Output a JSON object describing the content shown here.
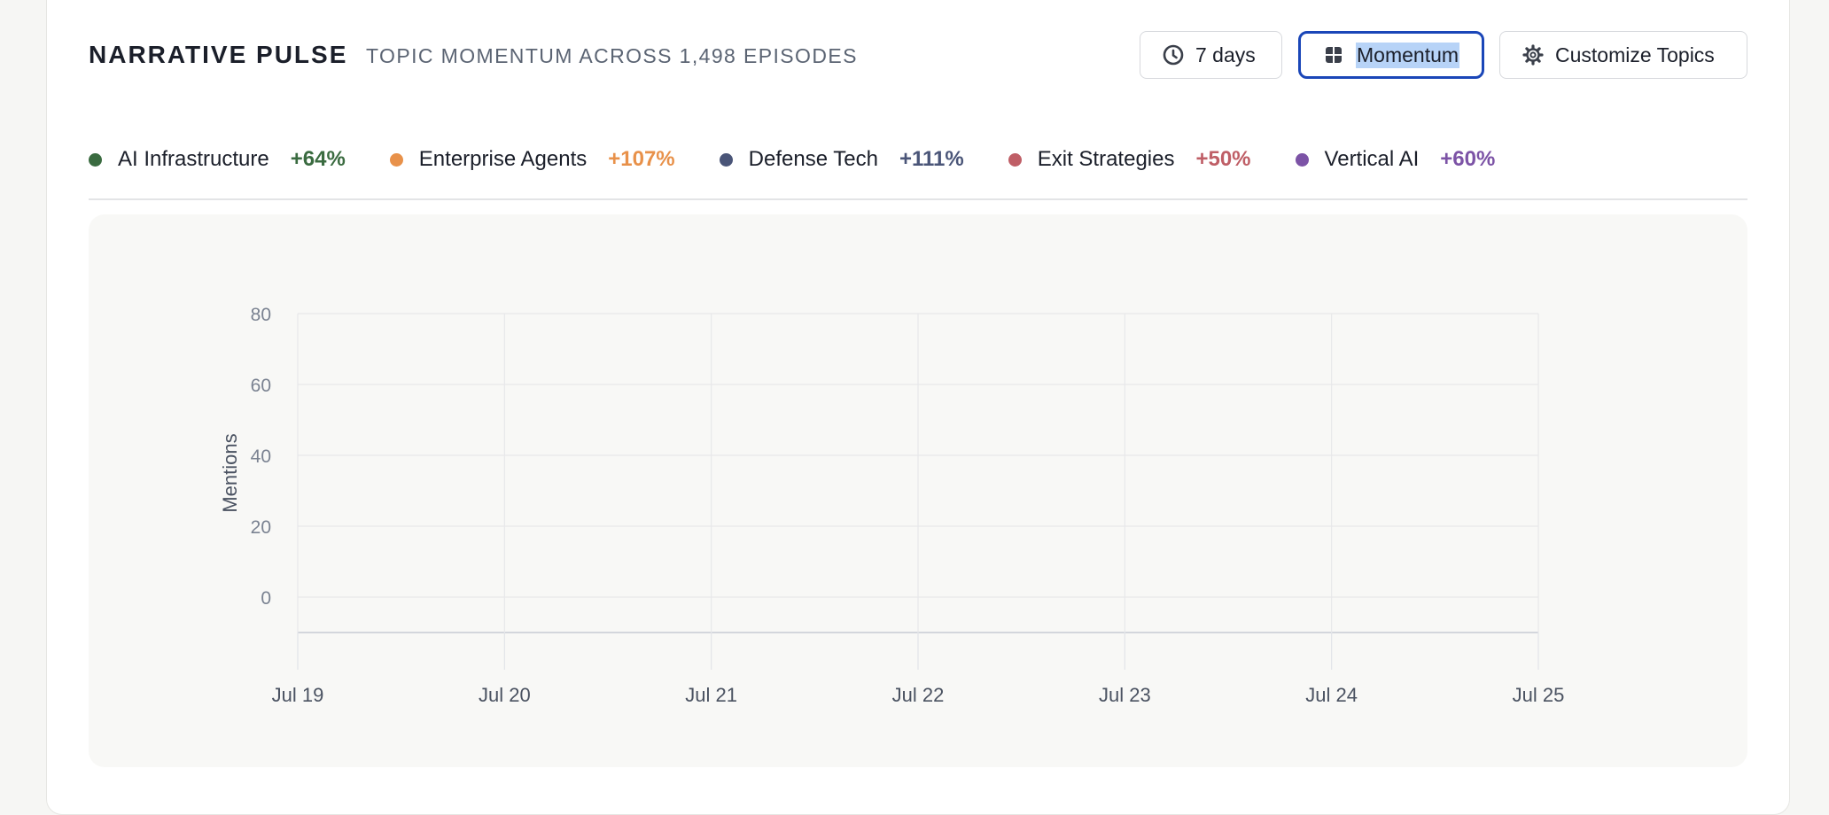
{
  "header": {
    "title": "NARRATIVE PULSE",
    "subtitle": "TOPIC MOMENTUM ACROSS 1,498 EPISODES"
  },
  "toolbar": {
    "range_label": "7 days",
    "range_icon": "clock-icon",
    "view_label": "Momentum",
    "view_icon": "grid-icon",
    "customize_label": "Customize Topics",
    "customize_icon": "gear-icon"
  },
  "legend": [
    {
      "label": "AI Infrastructure",
      "change": "+64%",
      "color": "#3a6b40"
    },
    {
      "label": "Enterprise Agents",
      "change": "+107%",
      "color": "#e8914a"
    },
    {
      "label": "Defense Tech",
      "change": "+111%",
      "color": "#4a5578"
    },
    {
      "label": "Exit Strategies",
      "change": "+50%",
      "color": "#bf5e66"
    },
    {
      "label": "Vertical AI",
      "change": "+60%",
      "color": "#7c53a6"
    }
  ],
  "chart_data": {
    "type": "line",
    "ylabel": "Mentions",
    "xlabel": "",
    "y_ticks": [
      80,
      60,
      40,
      20,
      0
    ],
    "ylim": [
      -10,
      80
    ],
    "categories": [
      "Jul 19",
      "Jul 20",
      "Jul 21",
      "Jul 22",
      "Jul 23",
      "Jul 24",
      "Jul 25"
    ],
    "grid": true,
    "series": []
  }
}
